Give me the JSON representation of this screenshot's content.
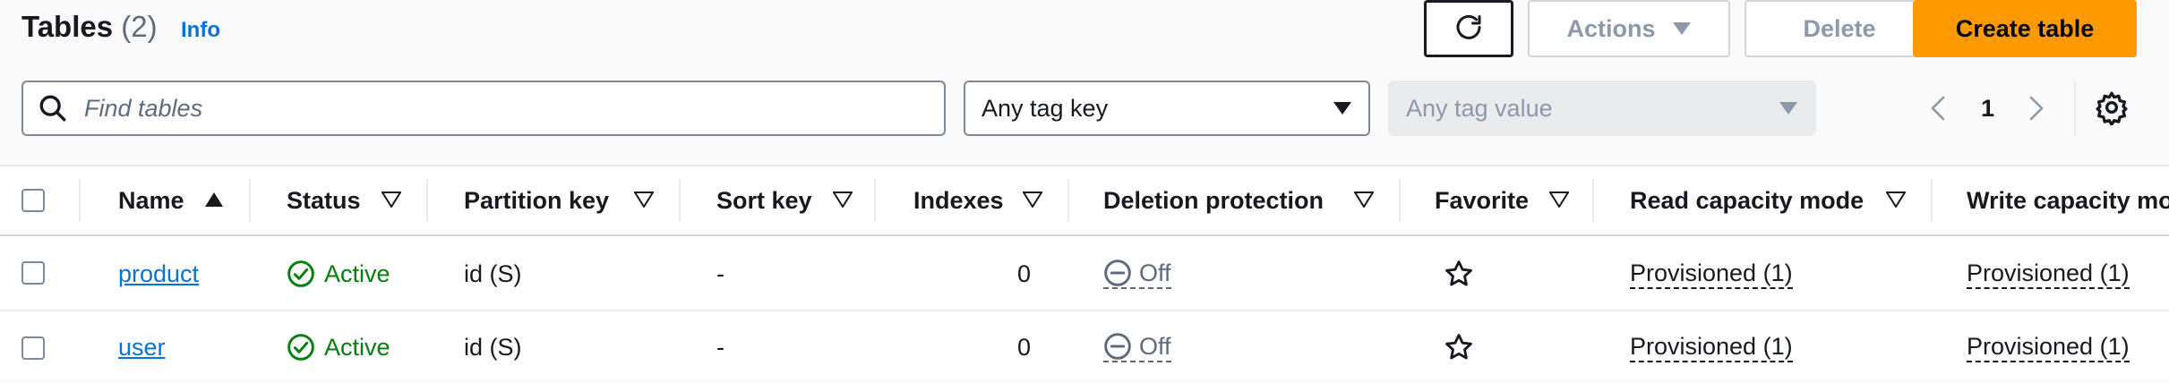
{
  "header": {
    "title": "Tables",
    "count": "(2)",
    "info": "Info"
  },
  "toolbar": {
    "refresh_icon": "refresh-icon",
    "actions_label": "Actions",
    "delete_label": "Delete",
    "create_label": "Create table",
    "create_color": "#ff9900"
  },
  "filters": {
    "search_placeholder": "Find tables",
    "tag_key": "Any tag key",
    "tag_value": "Any tag value"
  },
  "pagination": {
    "page": "1"
  },
  "table": {
    "columns": [
      "Name",
      "Status",
      "Partition key",
      "Sort key",
      "Indexes",
      "Deletion protection",
      "Favorite",
      "Read capacity mode",
      "Write capacity mo"
    ],
    "rows": [
      {
        "name": "product",
        "status": "Active",
        "partition_key": "id (S)",
        "sort_key": "-",
        "indexes": "0",
        "deletion_protection": "Off",
        "read_capacity": "Provisioned (1)",
        "write_capacity": "Provisioned (1)"
      },
      {
        "name": "user",
        "status": "Active",
        "partition_key": "id (S)",
        "sort_key": "-",
        "indexes": "0",
        "deletion_protection": "Off",
        "read_capacity": "Provisioned (1)",
        "write_capacity": "Provisioned (1)"
      }
    ]
  },
  "colors": {
    "link": "#0972d3",
    "success": "#037f0c",
    "muted": "#5f6b7a"
  }
}
